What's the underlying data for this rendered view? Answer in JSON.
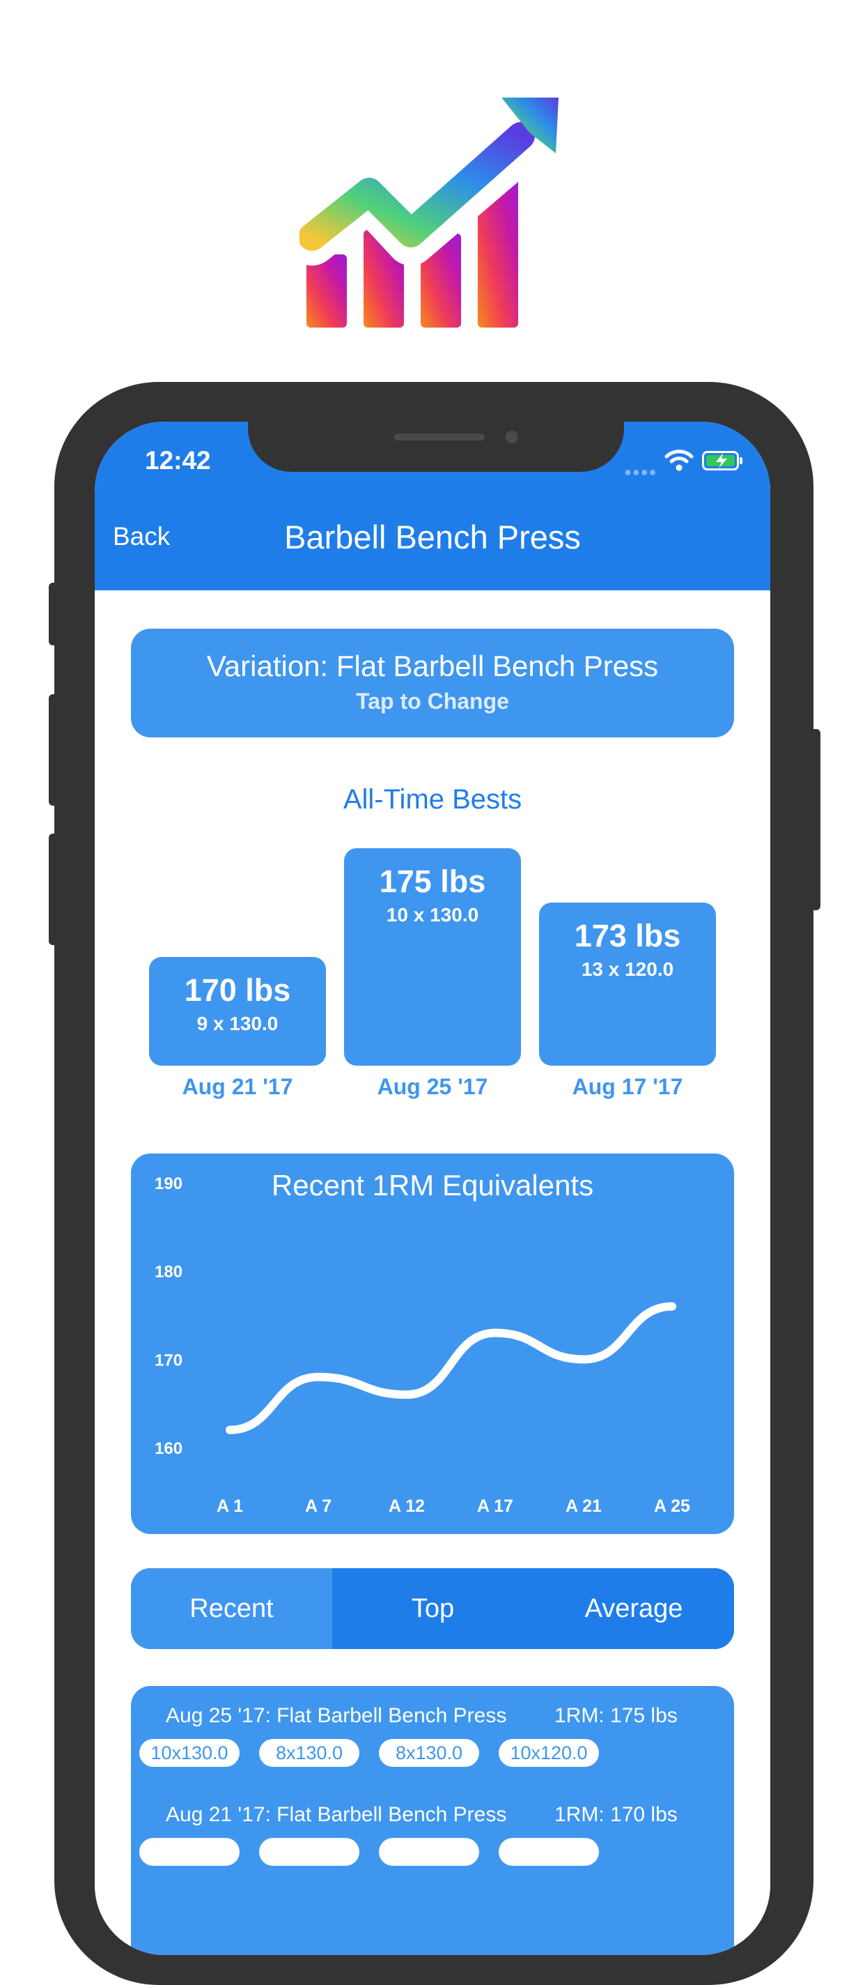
{
  "status_bar": {
    "time": "12:42"
  },
  "nav": {
    "back_label": "Back",
    "title": "Barbell Bench Press"
  },
  "variation": {
    "title": "Variation: Flat Barbell Bench Press",
    "subtitle": "Tap to Change"
  },
  "bests": {
    "title": "All-Time Bests",
    "items": [
      {
        "weight": "170 lbs",
        "reps": "9 x 130.0",
        "date": "Aug 21 '17",
        "value": 170
      },
      {
        "weight": "175 lbs",
        "reps": "10 x 130.0",
        "date": "Aug 25 '17",
        "value": 175
      },
      {
        "weight": "173 lbs",
        "reps": "13 x 120.0",
        "date": "Aug 17 '17",
        "value": 173
      }
    ]
  },
  "chart_data": {
    "type": "line",
    "title": "Recent 1RM Equivalents",
    "categories": [
      "A 1",
      "A 7",
      "A 12",
      "A 17",
      "A 21",
      "A 25"
    ],
    "values": [
      162,
      168,
      166,
      173,
      170,
      176
    ],
    "yticks": [
      190,
      180,
      170,
      160
    ],
    "ylim": [
      160,
      190
    ],
    "grid": false,
    "line_color": "#ffffff"
  },
  "tabs": {
    "items": [
      "Recent",
      "Top",
      "Average"
    ],
    "selected": "Top"
  },
  "history": {
    "entries": [
      {
        "title": "Aug 25 '17: Flat Barbell Bench Press",
        "one_rm": "1RM: 175 lbs",
        "sets": [
          "10x130.0",
          "8x130.0",
          "8x130.0",
          "10x120.0"
        ]
      },
      {
        "title": "Aug 21 '17: Flat Barbell Bench Press",
        "one_rm": "1RM: 170 lbs",
        "sets": []
      }
    ]
  },
  "colors": {
    "header": "#1f7dea",
    "card": "#3f96ef",
    "accent": "#1f7dea",
    "frame": "#333333"
  },
  "icons": {
    "app_logo": "trending-up-chart-icon",
    "wifi": "wifi-icon",
    "battery": "battery-charging-icon"
  }
}
